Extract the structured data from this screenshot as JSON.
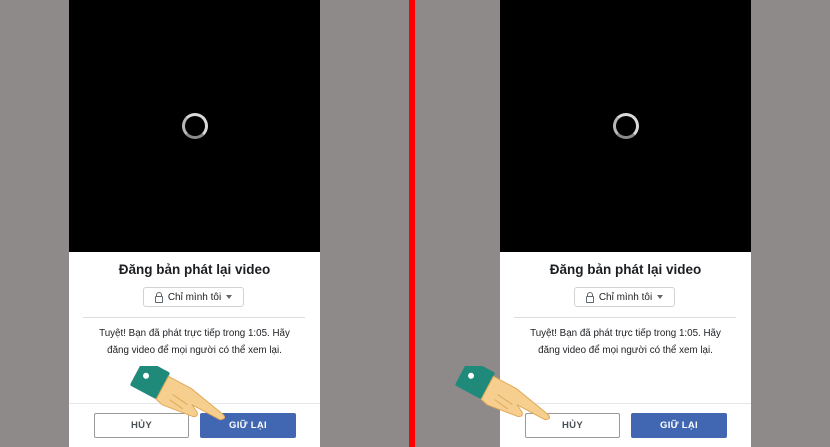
{
  "screens": [
    {
      "title": "Đăng bản phát lại video",
      "privacy_label": "Chỉ mình tôi",
      "message": "Tuyệt! Bạn đã phát trực tiếp trong 1:05. Hãy đăng video để mọi người có thể xem lại.",
      "cancel_label": "HỦY",
      "keep_label": "GIỮ LẠI"
    },
    {
      "title": "Đăng bản phát lại video",
      "privacy_label": "Chỉ mình tôi",
      "message": "Tuyệt! Bạn đã phát trực tiếp trong 1:05. Hãy đăng video để mọi người có thể xem lại.",
      "cancel_label": "HỦY",
      "keep_label": "GIỮ LẠI"
    }
  ],
  "colors": {
    "background": "#8f8a8a",
    "divider": "#ff0000",
    "primary_button": "#4267b2",
    "hand_sleeve": "#1f8a7a",
    "hand_skin": "#f6cf8e"
  },
  "icons": [
    "loading-spinner-icon",
    "lock-icon",
    "caret-down-icon",
    "pointing-hand-icon"
  ]
}
